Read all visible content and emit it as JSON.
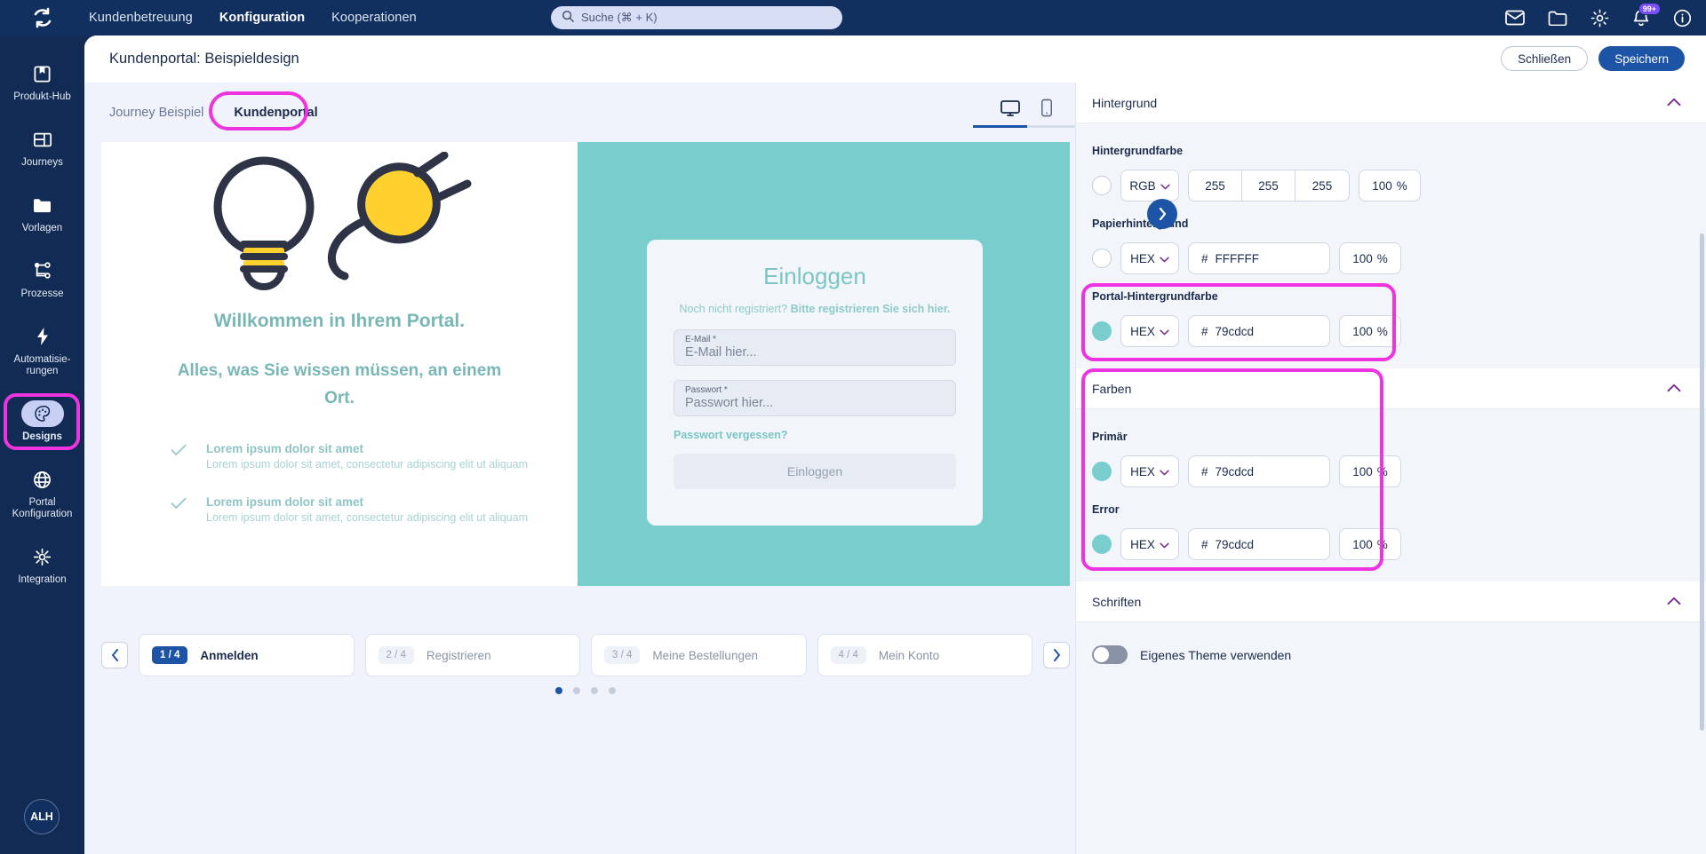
{
  "topbar": {
    "logo_icon": "refresh-cycle-logo",
    "nav": [
      {
        "label": "Kundenbetreuung",
        "active": false
      },
      {
        "label": "Konfiguration",
        "active": true
      },
      {
        "label": "Kooperationen",
        "active": false
      }
    ],
    "search": {
      "icon": "search-icon",
      "placeholder": "Suche (⌘ + K)"
    },
    "icons": [
      {
        "name": "mail-icon"
      },
      {
        "name": "folder-icon"
      },
      {
        "name": "gear-icon"
      },
      {
        "name": "bell-icon",
        "badge": "99+"
      },
      {
        "name": "info-icon"
      }
    ]
  },
  "sidebar": {
    "items": [
      {
        "label": "Produkt-Hub",
        "icon": "product-hub-icon",
        "active": false
      },
      {
        "label": "Journeys",
        "icon": "journeys-icon",
        "active": false
      },
      {
        "label": "Vorlagen",
        "icon": "folder-icon",
        "active": false
      },
      {
        "label": "Prozesse",
        "icon": "process-tree-icon",
        "active": false
      },
      {
        "label": "Automatisie-\nrungen",
        "icon": "lightning-icon",
        "active": false
      },
      {
        "label": "Designs",
        "icon": "palette-icon",
        "active": true
      },
      {
        "label": "Portal\nKonfiguration",
        "icon": "globe-icon",
        "active": false
      },
      {
        "label": "Integration",
        "icon": "integration-icon",
        "active": false
      }
    ],
    "avatar_initials": "ALH"
  },
  "header": {
    "title": "Kundenportal: Beispieldesign",
    "close_label": "Schließen",
    "save_label": "Speichern"
  },
  "workspace": {
    "tabs": [
      {
        "label": "Journey Beispiel",
        "active": false
      },
      {
        "label": "Kundenportal",
        "active": true
      }
    ],
    "device_toggle": {
      "desktop_icon": "monitor-icon",
      "mobile_icon": "phone-icon",
      "selected": "desktop"
    }
  },
  "preview": {
    "hero_icon": "lightbulb-plug-illustration",
    "welcome": "Willkommen in Ihrem Portal.",
    "tagline": "Alles, was Sie wissen müssen, an einem Ort.",
    "bullets": [
      {
        "check_icon": "check-icon",
        "title": "Lorem ipsum dolor sit amet",
        "desc": "Lorem ipsum dolor sit amet, consectetur adipiscing elit ut aliquam"
      },
      {
        "check_icon": "check-icon",
        "title": "Lorem ipsum dolor sit amet",
        "desc": "Lorem ipsum dolor sit amet, consectetur adipiscing elit ut aliquam"
      }
    ],
    "login": {
      "title": "Einloggen",
      "subtitle_prefix": "Noch nicht registriert? ",
      "subtitle_link": "Bitte registrieren Sie sich hier.",
      "email_label": "E-Mail *",
      "email_placeholder": "E-Mail hier...",
      "password_label": "Passwort *",
      "password_placeholder": "Passwort hier...",
      "forgot_label": "Passwort vergessen?",
      "submit_label": "Einloggen"
    },
    "panel_bg_color": "#79cdcd"
  },
  "steps": {
    "prev_icon": "chevron-left-icon",
    "next_icon": "chevron-right-icon",
    "items": [
      {
        "counter": "1 / 4",
        "label": "Anmelden",
        "active": true
      },
      {
        "counter": "2 / 4",
        "label": "Registrieren",
        "active": false
      },
      {
        "counter": "3 / 4",
        "label": "Meine Bestellungen",
        "active": false
      },
      {
        "counter": "4 / 4",
        "label": "Mein Konto",
        "active": false
      }
    ],
    "dots": [
      true,
      false,
      false,
      false
    ]
  },
  "right_panel": {
    "collapse_icon": "chevron-right-icon",
    "sections": [
      {
        "title": "Hintergrund",
        "chevron": "chevron-up-icon",
        "fields": [
          {
            "label": "Hintergrundfarbe",
            "swatch": "#FFFFFF",
            "mode": "RGB",
            "rgb": [
              "255",
              "255",
              "255"
            ],
            "alpha": "100",
            "alpha_unit": "%",
            "highlighted": false
          },
          {
            "label": "Papierhintergrund",
            "swatch": "#FFFFFF",
            "mode": "HEX",
            "hash": "#",
            "hex": "FFFFFF",
            "alpha": "100",
            "alpha_unit": "%",
            "highlighted": false
          },
          {
            "label": "Portal-Hintergrundfarbe",
            "swatch": "#79cdcd",
            "mode": "HEX",
            "hash": "#",
            "hex": "79cdcd",
            "alpha": "100",
            "alpha_unit": "%",
            "highlighted": true
          }
        ]
      },
      {
        "title": "Farben",
        "chevron": "chevron-up-icon",
        "highlighted": true,
        "fields": [
          {
            "label": "Primär",
            "swatch": "#79cdcd",
            "mode": "HEX",
            "hash": "#",
            "hex": "79cdcd",
            "alpha": "100",
            "alpha_unit": "%"
          },
          {
            "label": "Error",
            "swatch": "#79cdcd",
            "mode": "HEX",
            "hash": "#",
            "hex": "79cdcd",
            "alpha": "100",
            "alpha_unit": "%"
          }
        ]
      },
      {
        "title": "Schriften",
        "chevron": "chevron-up-icon"
      }
    ],
    "theme_toggle": {
      "label": "Eigenes Theme verwenden",
      "on": false
    }
  },
  "colors": {
    "navy": "#122B54",
    "navy_bar": "#12305F",
    "blue": "#1D54A6",
    "magenta_highlight": "#EE34E0",
    "teal": "#79cdcd"
  }
}
